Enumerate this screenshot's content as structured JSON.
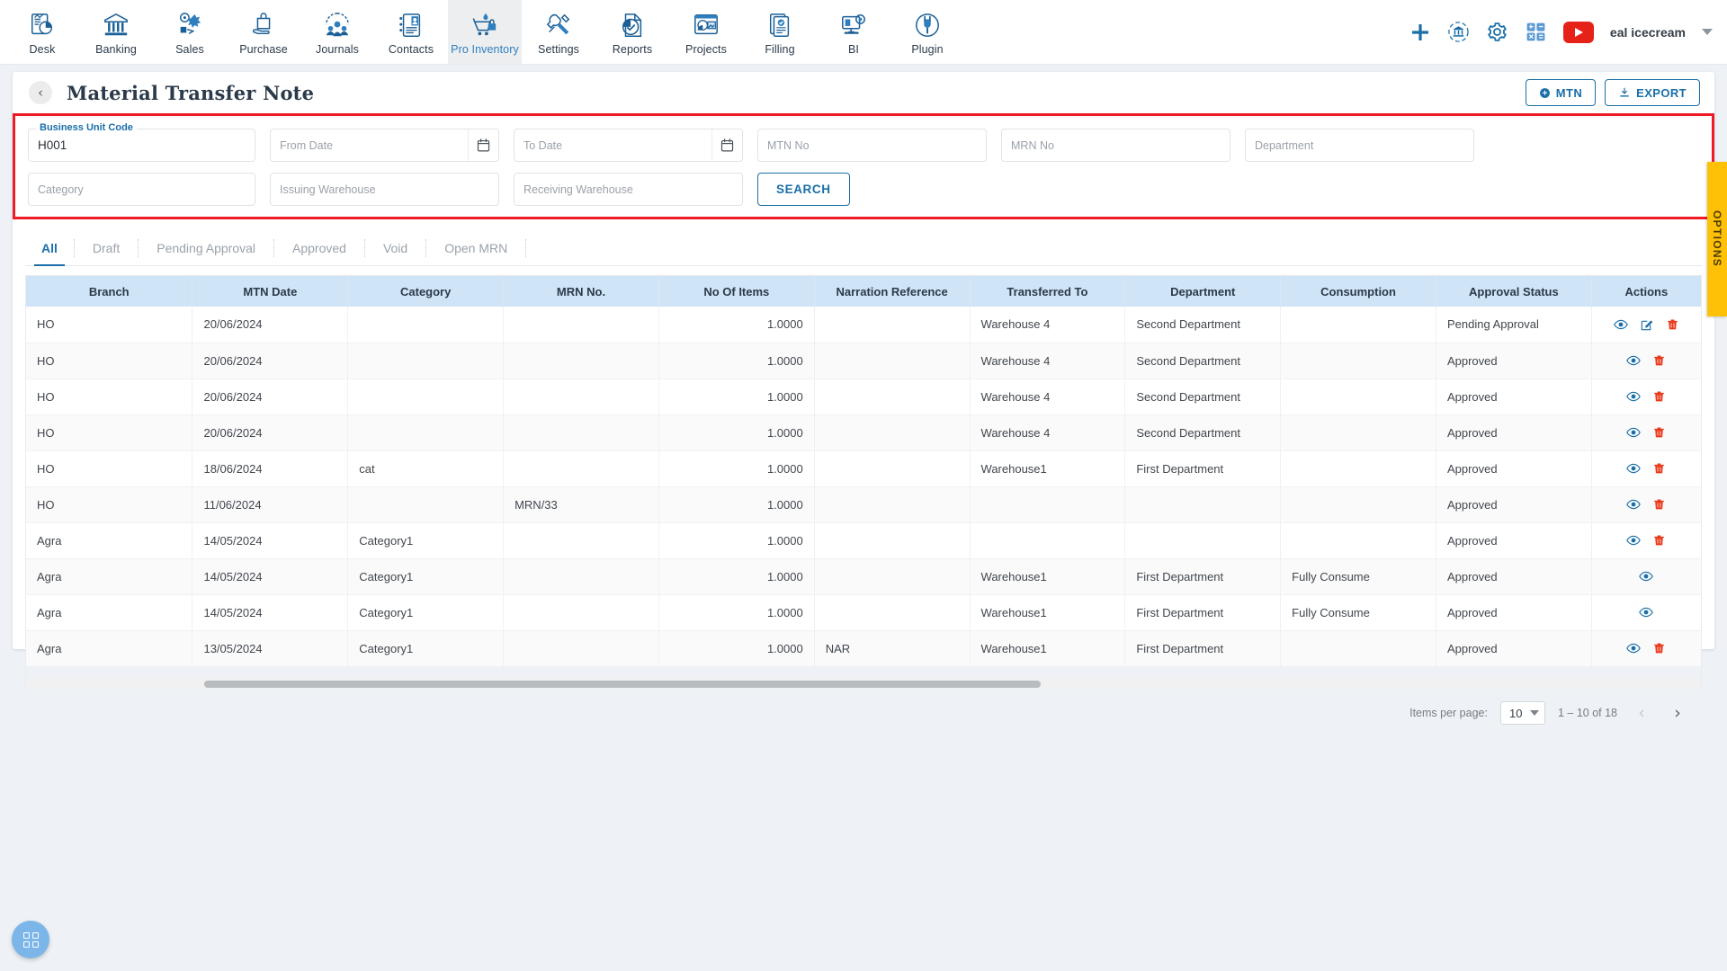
{
  "topnav": {
    "items": [
      {
        "label": "Desk",
        "icon": "desk-chart-icon",
        "active": false
      },
      {
        "label": "Banking",
        "icon": "bank-icon",
        "active": false
      },
      {
        "label": "Sales",
        "icon": "sales-tag-icon",
        "active": false
      },
      {
        "label": "Purchase",
        "icon": "purchase-bag-icon",
        "active": false
      },
      {
        "label": "Journals",
        "icon": "journals-gear-people-icon",
        "active": false
      },
      {
        "label": "Contacts",
        "icon": "contacts-card-icon",
        "active": false
      },
      {
        "label": "Pro Inventory",
        "icon": "inventory-cart-icon",
        "active": true
      },
      {
        "label": "Settings",
        "icon": "settings-tools-icon",
        "active": false
      },
      {
        "label": "Reports",
        "icon": "reports-piechart-icon",
        "active": false
      },
      {
        "label": "Projects",
        "icon": "projects-board-icon",
        "active": false
      },
      {
        "label": "Filling",
        "icon": "filling-doc-icon",
        "active": false
      },
      {
        "label": "BI",
        "icon": "bi-monitor-icon",
        "active": false
      },
      {
        "label": "Plugin",
        "icon": "plugin-plug-icon",
        "active": false
      }
    ],
    "right_icons": [
      {
        "name": "add-plus-icon"
      },
      {
        "name": "bank-sync-icon"
      },
      {
        "name": "gear-settings-icon"
      },
      {
        "name": "calculator-icon"
      },
      {
        "name": "youtube-icon"
      }
    ],
    "user_name": "eal icecream",
    "caret": "chevron-down-icon"
  },
  "header": {
    "back_label": "‹",
    "title": "Material Transfer Note",
    "mtn_button": "MTN",
    "export_button": "EXPORT"
  },
  "filters": {
    "business_unit_code": {
      "label": "Business Unit Code",
      "value": "H001"
    },
    "from_date": {
      "placeholder": "From Date",
      "value": ""
    },
    "to_date": {
      "placeholder": "To Date",
      "value": ""
    },
    "mtn_no": {
      "placeholder": "MTN No",
      "value": ""
    },
    "mrn_no": {
      "placeholder": "MRN No",
      "value": ""
    },
    "department": {
      "placeholder": "Department",
      "value": ""
    },
    "category": {
      "placeholder": "Category",
      "value": ""
    },
    "issuing_warehouse": {
      "placeholder": "Issuing Warehouse",
      "value": ""
    },
    "receiving_warehouse": {
      "placeholder": "Receiving Warehouse",
      "value": ""
    },
    "search_button": "SEARCH",
    "highlight_color": "#ee1b24"
  },
  "tabs": [
    {
      "label": "All",
      "active": true
    },
    {
      "label": "Draft",
      "active": false
    },
    {
      "label": "Pending Approval",
      "active": false
    },
    {
      "label": "Approved",
      "active": false
    },
    {
      "label": "Void",
      "active": false
    },
    {
      "label": "Open MRN",
      "active": false
    }
  ],
  "table": {
    "columns": [
      "Branch",
      "MTN Date",
      "Category",
      "MRN No.",
      "No Of Items",
      "Narration Reference",
      "Transferred To",
      "Department",
      "Consumption",
      "Approval Status",
      "Actions"
    ],
    "rows": [
      {
        "branch": "HO",
        "mtn_date": "20/06/2024",
        "category": "",
        "mrn_no": "",
        "no_of_items": "1.0000",
        "narration": "",
        "transferred_to": "Warehouse 4",
        "department": "Second Department",
        "consumption": "",
        "status": "Pending Approval",
        "actions": [
          "view",
          "edit",
          "delete"
        ]
      },
      {
        "branch": "HO",
        "mtn_date": "20/06/2024",
        "category": "",
        "mrn_no": "",
        "no_of_items": "1.0000",
        "narration": "",
        "transferred_to": "Warehouse 4",
        "department": "Second Department",
        "consumption": "",
        "status": "Approved",
        "actions": [
          "view",
          "delete"
        ]
      },
      {
        "branch": "HO",
        "mtn_date": "20/06/2024",
        "category": "",
        "mrn_no": "",
        "no_of_items": "1.0000",
        "narration": "",
        "transferred_to": "Warehouse 4",
        "department": "Second Department",
        "consumption": "",
        "status": "Approved",
        "actions": [
          "view",
          "delete"
        ]
      },
      {
        "branch": "HO",
        "mtn_date": "20/06/2024",
        "category": "",
        "mrn_no": "",
        "no_of_items": "1.0000",
        "narration": "",
        "transferred_to": "Warehouse 4",
        "department": "Second Department",
        "consumption": "",
        "status": "Approved",
        "actions": [
          "view",
          "delete"
        ]
      },
      {
        "branch": "HO",
        "mtn_date": "18/06/2024",
        "category": "cat",
        "mrn_no": "",
        "no_of_items": "1.0000",
        "narration": "",
        "transferred_to": "Warehouse1",
        "department": "First Department",
        "consumption": "",
        "status": "Approved",
        "actions": [
          "view",
          "delete"
        ]
      },
      {
        "branch": "HO",
        "mtn_date": "11/06/2024",
        "category": "",
        "mrn_no": "MRN/33",
        "no_of_items": "1.0000",
        "narration": "",
        "transferred_to": "",
        "department": "",
        "consumption": "",
        "status": "Approved",
        "actions": [
          "view",
          "delete"
        ]
      },
      {
        "branch": "Agra",
        "mtn_date": "14/05/2024",
        "category": "Category1",
        "mrn_no": "",
        "no_of_items": "1.0000",
        "narration": "",
        "transferred_to": "",
        "department": "",
        "consumption": "",
        "status": "Approved",
        "actions": [
          "view",
          "delete"
        ]
      },
      {
        "branch": "Agra",
        "mtn_date": "14/05/2024",
        "category": "Category1",
        "mrn_no": "",
        "no_of_items": "1.0000",
        "narration": "",
        "transferred_to": "Warehouse1",
        "department": "First Department",
        "consumption": "Fully Consume",
        "status": "Approved",
        "actions": [
          "view"
        ]
      },
      {
        "branch": "Agra",
        "mtn_date": "14/05/2024",
        "category": "Category1",
        "mrn_no": "",
        "no_of_items": "1.0000",
        "narration": "",
        "transferred_to": "Warehouse1",
        "department": "First Department",
        "consumption": "Fully Consume",
        "status": "Approved",
        "actions": [
          "view"
        ]
      },
      {
        "branch": "Agra",
        "mtn_date": "13/05/2024",
        "category": "Category1",
        "mrn_no": "",
        "no_of_items": "1.0000",
        "narration": "NAR",
        "transferred_to": "Warehouse1",
        "department": "First Department",
        "consumption": "",
        "status": "Approved",
        "actions": [
          "view",
          "delete"
        ]
      }
    ]
  },
  "paginator": {
    "items_per_page_label": "Items per page:",
    "items_per_page_value": "10",
    "range_label": "1 – 10 of 18",
    "prev_icon": "chevron-left-icon",
    "next_icon": "chevron-right-icon"
  },
  "options_tab": {
    "label": "OPTIONS",
    "color": "#ffc107"
  },
  "fab": {
    "icon": "grid-apps-icon",
    "color": "#7cb6e8"
  }
}
